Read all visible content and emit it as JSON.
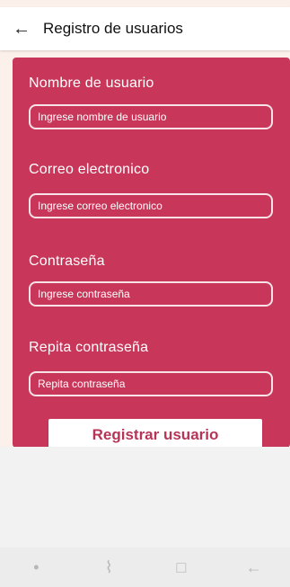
{
  "app_bar": {
    "title": "Registro de usuarios",
    "back_icon": "←"
  },
  "form": {
    "fields": [
      {
        "label": "Nombre de usuario",
        "placeholder": "Ingrese nombre de usuario"
      },
      {
        "label": "Correo electronico",
        "placeholder": "Ingrese correo electronico"
      },
      {
        "label": "Contraseña",
        "placeholder": "Ingrese contraseña"
      },
      {
        "label": "Repita contraseña",
        "placeholder": "Repita contraseña"
      }
    ],
    "button_label": "Registrar usuario"
  },
  "system_nav": {
    "dot": "•",
    "recent": "⌇",
    "home": "□",
    "back": "←"
  },
  "colors": {
    "accent": "#c8375a",
    "background": "#fbf1ea",
    "appbar": "#ffffff"
  }
}
